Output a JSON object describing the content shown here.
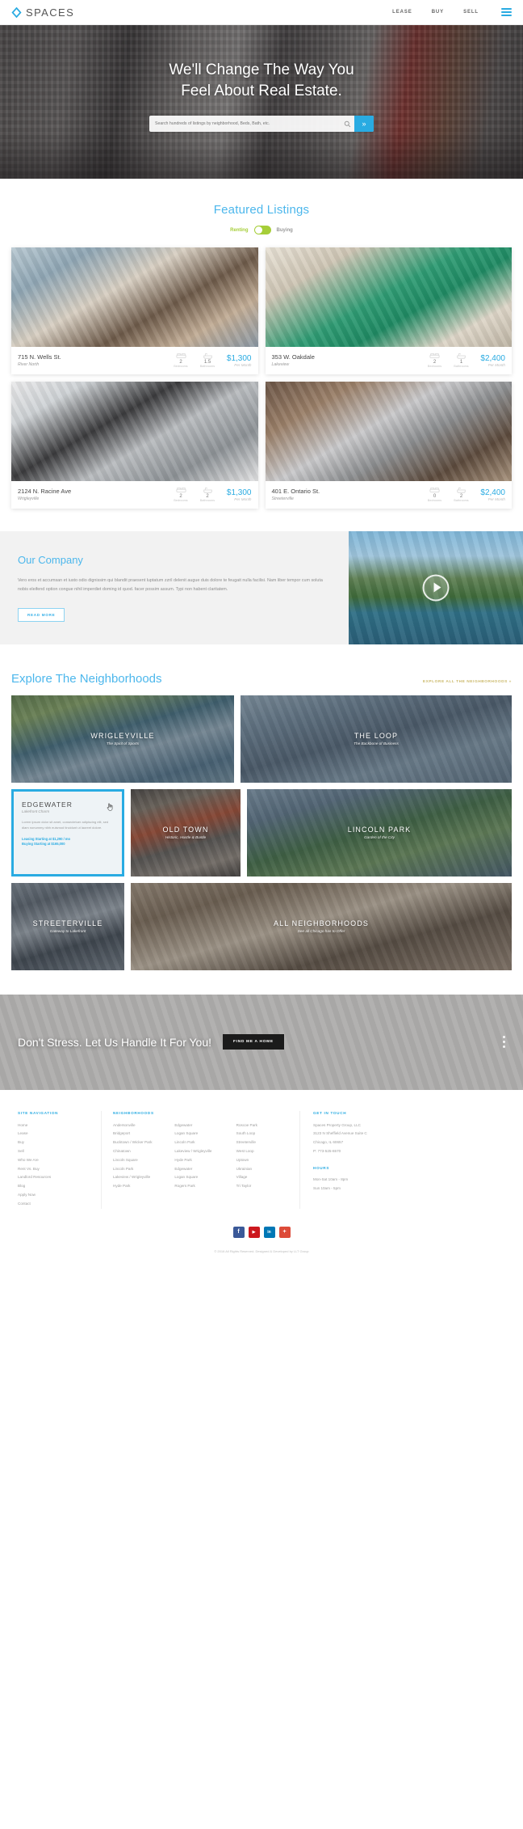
{
  "header": {
    "brand": "SPACES",
    "logo_icon": "diamond-logo-icon",
    "nav": [
      {
        "label": "LEASE"
      },
      {
        "label": "BUY"
      },
      {
        "label": "SELL"
      }
    ],
    "menu_icon": "hamburger-menu-icon"
  },
  "hero": {
    "headline_line1": "We'll Change The Way You",
    "headline_line2": "Feel About Real Estate.",
    "search_placeholder": "Search hundreds of listings by neighborhood, Beds, Bath, etc.",
    "search_value": "",
    "search_icon": "magnifier-icon",
    "submit_icon": "double-chevron-right-icon"
  },
  "featured": {
    "title": "Featured Listings",
    "toggle": {
      "left_label": "Renting",
      "right_label": "Buying",
      "state": "Renting",
      "accent": "#a6ce39"
    },
    "listings": [
      {
        "name": "715 N. Wells St.",
        "neighborhood": "River North",
        "beds": "2",
        "beds_label": "Bedrooms",
        "baths": "1.5",
        "baths_label": "Bathrooms",
        "price": "$1,300",
        "period": "Per Month"
      },
      {
        "name": "353 W. Oakdale",
        "neighborhood": "Lakeview",
        "beds": "2",
        "beds_label": "Bedrooms",
        "baths": "1",
        "baths_label": "Bathrooms",
        "price": "$2,400",
        "period": "Per Month"
      },
      {
        "name": "2124 N. Racine Ave",
        "neighborhood": "Wrigleyville",
        "beds": "2",
        "beds_label": "Bedrooms",
        "baths": "2",
        "baths_label": "Bathrooms",
        "price": "$1,300",
        "period": "Per Month"
      },
      {
        "name": "401 E. Ontario St.",
        "neighborhood": "Streeterville",
        "beds": "0",
        "beds_label": "Bedrooms",
        "baths": "2",
        "baths_label": "Bathrooms",
        "price": "$2,400",
        "period": "Per Month"
      }
    ]
  },
  "company": {
    "title": "Our Company",
    "body": "Vero eros et accumsan et iusto odio dignissim qui blandit praesent luptatum zzril delenit augue duis dolore te feugait nulla facilisi. Nam liber tempor cum soluta nobis eleifend option congue nihil imperdiet doming id quod. facer possim assum. Typi non habent claritatem.",
    "button": "READ MORE",
    "play_icon": "play-button-icon"
  },
  "neighborhoods": {
    "title": "Explore The Neighborhoods",
    "all_link": "EXPLORE ALL THE NEIGHBORHOODS",
    "all_link_icon": "double-chevron-right-icon",
    "items": [
      {
        "name": "WRIGLEYVILLE",
        "tagline": "The Spirit of Sports"
      },
      {
        "name": "THE LOOP",
        "tagline": "The Backbone of Business"
      },
      {
        "name": "OLD TOWN",
        "tagline": "Historic, Hustle & Bustle"
      },
      {
        "name": "LINCOLN PARK",
        "tagline": "Garden of the City"
      },
      {
        "name": "STREETERVILLE",
        "tagline": "Gateway to Lakefront"
      },
      {
        "name": "ALL NEIGHBORHOODS",
        "tagline": "See all Chicago has to Offer"
      }
    ],
    "highlight": {
      "name": "EDGEWATER",
      "tagline": "Lakefront Charm",
      "body": "Lorem ipsum dolor sit amet, consectetuer adipiscing elit, sed diam nonummy nibh euismod tincidunt ut laoreet dolore.",
      "leasing": "Leasing Starting at $1,290 / mo",
      "buying": "Buying Starting at $165,000",
      "cursor_icon": "hand-pointer-icon"
    }
  },
  "cta": {
    "text": "Don't Stress. Let Us Handle It For You!",
    "button": "FIND ME A HOME",
    "menu_icon": "vertical-dots-icon"
  },
  "footer": {
    "site_navigation": {
      "heading": "SITE NAVIGATION",
      "links": [
        "Home",
        "Lease",
        "Buy",
        "Sell",
        "Who We Are",
        "Rent Vs. Buy",
        "Landlord Resources",
        "Blog",
        "Apply Now",
        "Contact"
      ]
    },
    "neighborhoods": {
      "heading": "NEIGHBORHOODS",
      "col1": [
        "Andersonville",
        "Bridgeport",
        "Bucktown / Wicker Park",
        "Chinatown",
        "Lincoln Square",
        "Lincoln Park",
        "Lakeview / Wrigleyville",
        "Hyde Park"
      ],
      "col2": [
        "Edgewater",
        "Logan Square",
        "Lincoln Park",
        "Lakeview / Wrigleyville",
        "Hyde Park",
        "Edgewater",
        "Logan Square",
        "Rogers Park"
      ],
      "col3": [
        "Roscoe Park",
        "South Loop",
        "Streeterville",
        "West Loop",
        "Uptown",
        "Ukrainian",
        "Village",
        "Tri Taylor"
      ]
    },
    "get_in_touch": {
      "heading": "GET IN TOUCH",
      "company": "Spaces Property Group, LLC",
      "address1": "3123 N Sheffield Avenue Suite C",
      "address2": "Chicago, IL 60657",
      "phone": "P: 773-525-6570",
      "hours_heading": "HOURS",
      "hours1": "Mon-Sat 10am - 8pm",
      "hours2": "Sun 10am - 5pm"
    },
    "social": [
      {
        "name": "facebook-icon",
        "glyph": "f",
        "color": "#3b5998"
      },
      {
        "name": "youtube-icon",
        "glyph": "▶",
        "color": "#cc181e"
      },
      {
        "name": "linkedin-icon",
        "glyph": "in",
        "color": "#0077b5"
      },
      {
        "name": "googleplus-icon",
        "glyph": "+",
        "color": "#dd4b39"
      }
    ],
    "copyright": "© 2016 All Rights Reserved. Designed & Developed by LLT Group"
  }
}
